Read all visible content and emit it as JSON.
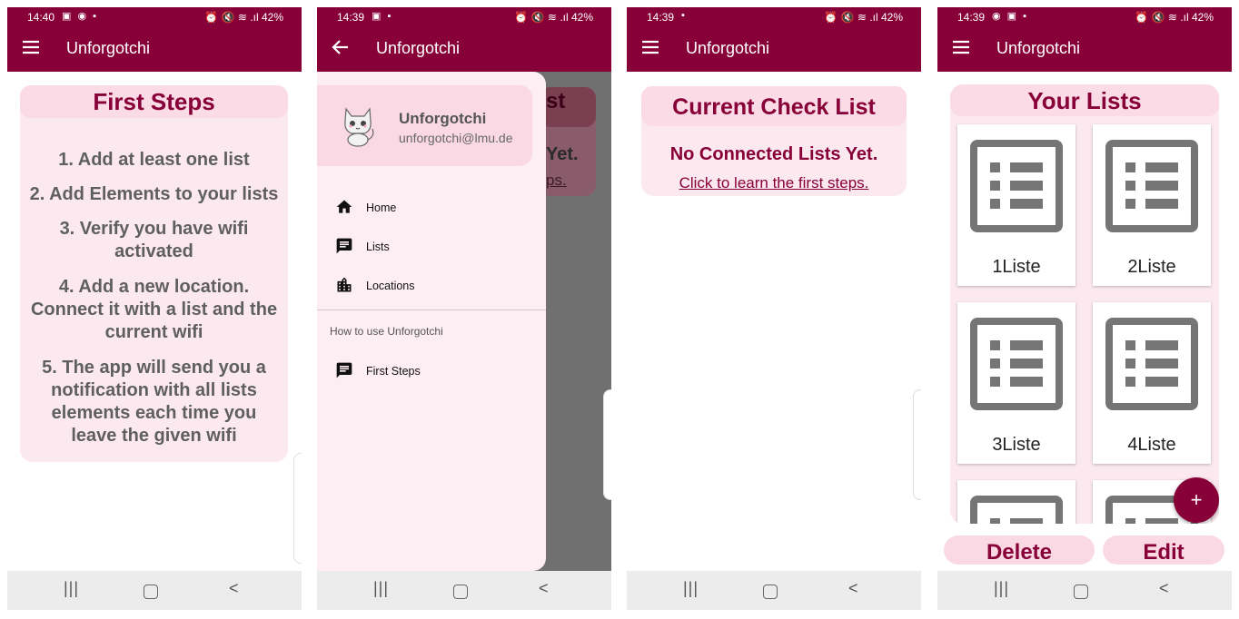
{
  "screens": [
    {
      "status": {
        "time": "14:40",
        "left_icons": "▣ ◉ ▪",
        "right": "⏰ 🔇 ≋ .ıl 42%"
      },
      "appbar": {
        "title": "Unforgotchi",
        "nav_icon": "menu-icon"
      },
      "first_steps": {
        "title": "First Steps",
        "steps": [
          "1. Add at least one list",
          "2. Add Elements to your lists",
          "3. Verify you have wifi activated",
          "4. Add a new location. Connect it with a list and the current wifi",
          "5. The app will send you a notification with all lists elements each time you leave the given wifi"
        ]
      }
    },
    {
      "status": {
        "time": "14:39",
        "left_icons": "▣ ▪",
        "right": "⏰ 🔇 ≋ .ıl 42%"
      },
      "appbar": {
        "title": "Unforgotchi",
        "nav_icon": "back-arrow-icon"
      },
      "background": {
        "title_fragment": "st",
        "line1_fragment": "Yet.",
        "line2_fragment": "ps."
      },
      "drawer": {
        "user_name": "Unforgotchi",
        "user_email": "unforgotchi@lmu.de",
        "items": [
          {
            "label": "Home",
            "icon": "home-icon"
          },
          {
            "label": "Lists",
            "icon": "message-icon"
          },
          {
            "label": "Locations",
            "icon": "location-city-icon"
          }
        ],
        "section_title": "How to use Unforgotchi",
        "section_items": [
          {
            "label": "First Steps",
            "icon": "message-icon"
          }
        ]
      }
    },
    {
      "status": {
        "time": "14:39",
        "left_icons": "▪",
        "right": "⏰ 🔇 ≋ .ıl 42%"
      },
      "appbar": {
        "title": "Unforgotchi",
        "nav_icon": "menu-icon"
      },
      "check_list": {
        "title": "Current Check List",
        "empty_message": "No Connected Lists Yet.",
        "link": "Click to learn the first steps."
      }
    },
    {
      "status": {
        "time": "14:39",
        "left_icons": "◉ ▣ ▪",
        "right": "⏰ 🔇 ≋ .ıl 42%"
      },
      "appbar": {
        "title": "Unforgotchi",
        "nav_icon": "menu-icon"
      },
      "your_lists": {
        "title": "Your Lists",
        "lists": [
          "1Liste",
          "2Liste",
          "3Liste",
          "4Liste",
          "",
          ""
        ],
        "fab": "+",
        "delete_label": "Delete",
        "edit_label": "Edit"
      }
    }
  ],
  "navbar": {
    "recent": "|||",
    "back": "<"
  },
  "colors": {
    "primary": "#880038",
    "card": "#fce9f0",
    "pill": "#fad9e5",
    "icon_gray": "#757575"
  }
}
